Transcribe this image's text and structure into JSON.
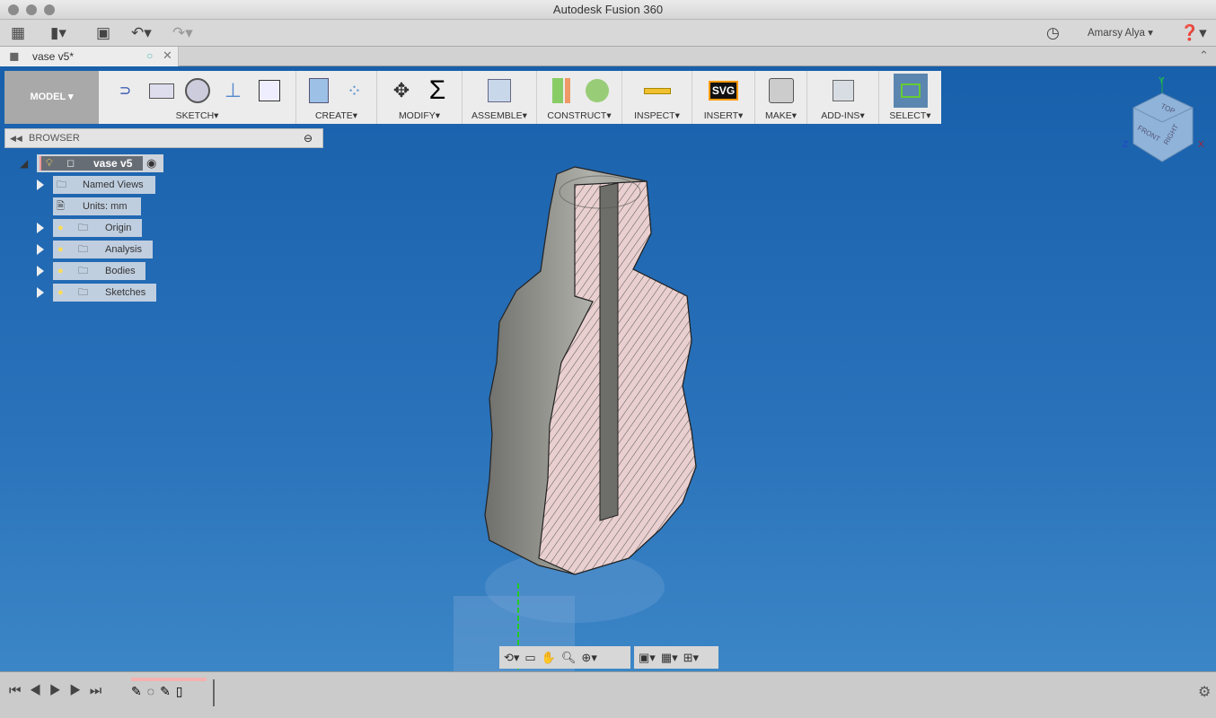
{
  "window": {
    "title": "Autodesk Fusion 360"
  },
  "quick_access": {
    "user": "Amarsy Alya",
    "icons": [
      "app-grid-icon",
      "file-icon",
      "save-icon",
      "undo-icon",
      "redo-icon",
      "clock-icon",
      "help-icon"
    ]
  },
  "document_tab": {
    "label": "vase v5*"
  },
  "ribbon": {
    "workspace": "MODEL",
    "groups": [
      {
        "label": "SKETCH"
      },
      {
        "label": "CREATE"
      },
      {
        "label": "MODIFY"
      },
      {
        "label": "ASSEMBLE"
      },
      {
        "label": "CONSTRUCT"
      },
      {
        "label": "INSPECT"
      },
      {
        "label": "INSERT"
      },
      {
        "label": "MAKE"
      },
      {
        "label": "ADD-INS"
      },
      {
        "label": "SELECT"
      }
    ],
    "svg_icon_text": "SVG"
  },
  "browser": {
    "header": "BROWSER",
    "root": "vase v5",
    "items": [
      {
        "label": "Named Views"
      },
      {
        "label": "Units: mm"
      },
      {
        "label": "Origin"
      },
      {
        "label": "Analysis"
      },
      {
        "label": "Bodies"
      },
      {
        "label": "Sketches"
      }
    ]
  },
  "viewcube": {
    "faces": [
      "TOP",
      "FRONT",
      "RIGHT"
    ],
    "axes": [
      "Y",
      "Z",
      "X"
    ]
  },
  "colors": {
    "viewport": "#1d62ad",
    "section_face": "#e9cfcf",
    "ribbon": "#ececec",
    "select_active": "#5b86b0"
  }
}
